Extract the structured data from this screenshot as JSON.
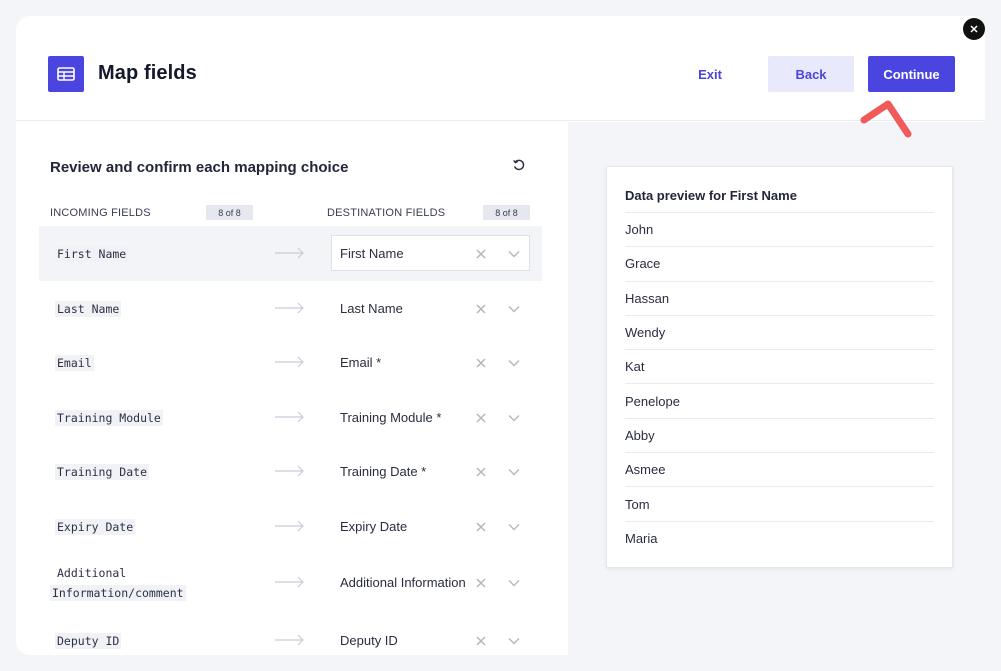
{
  "header": {
    "title": "Map fields",
    "title_icon": "table-icon",
    "exit_label": "Exit",
    "back_label": "Back",
    "continue_label": "Continue"
  },
  "mapping": {
    "title": "Review and confirm each mapping choice",
    "incoming_header": "INCOMING FIELDS",
    "destination_header": "DESTINATION FIELDS",
    "incoming_count": "8 of 8",
    "destination_count": "8 of 8",
    "rows": [
      {
        "incoming": "First Name",
        "destination": "First Name"
      },
      {
        "incoming": "Last Name",
        "destination": "Last Name"
      },
      {
        "incoming": "Email",
        "destination": "Email *"
      },
      {
        "incoming": "Training Module",
        "destination": "Training Module *"
      },
      {
        "incoming": "Training Date",
        "destination": "Training Date *"
      },
      {
        "incoming": "Expiry Date",
        "destination": "Expiry Date"
      },
      {
        "incoming_line1": "Additional",
        "incoming_line2": "Information/comment",
        "destination": "Additional Information"
      },
      {
        "incoming": "Deputy ID",
        "destination": "Deputy ID"
      }
    ]
  },
  "preview": {
    "title": "Data preview for First Name",
    "values": [
      "John",
      "Grace",
      "Hassan",
      "Wendy",
      "Kat",
      "Penelope",
      "Abby",
      "Asmee",
      "Tom",
      "Maria"
    ]
  },
  "colors": {
    "accent": "#4b45e0",
    "accent_light": "#e8e9fb",
    "annotation": "#f05a5a"
  }
}
